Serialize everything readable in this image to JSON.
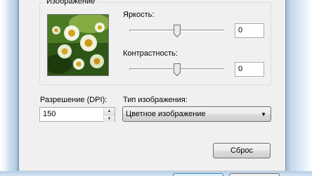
{
  "image_group": {
    "legend": "Изображение",
    "brightness": {
      "label": "Яркость:",
      "value": "0",
      "level": 0.5
    },
    "contrast": {
      "label": "Контрастность:",
      "value": "0",
      "level": 0.5
    }
  },
  "resolution": {
    "label": "Разрешение (DPI):",
    "value": "150"
  },
  "image_type": {
    "label": "Тип изображения:",
    "selected": "Цветное изображение"
  },
  "reset_button": "Сброс",
  "icons": {
    "spin_up": "spin-up-icon",
    "spin_down": "spin-down-icon",
    "dropdown": "chevron-down-icon"
  }
}
